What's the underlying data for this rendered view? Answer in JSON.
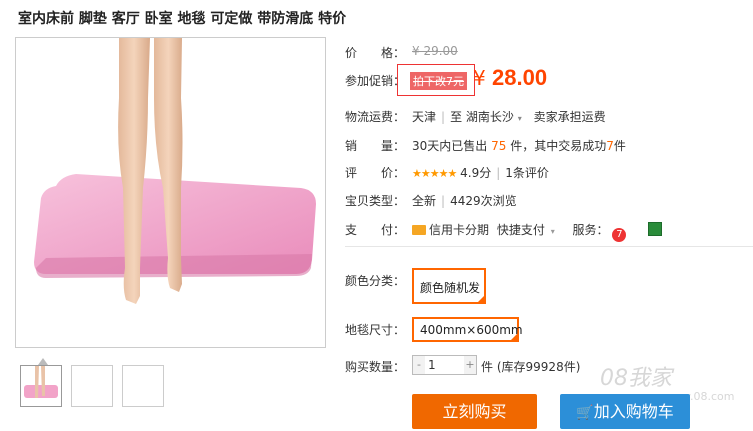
{
  "product": {
    "title": "室内床前 脚垫 客厅 卧室 地毯 可定做 带防滑底 特价"
  },
  "price_section": {
    "price_label": "价　　格：",
    "original_price": "¥ 29.00",
    "promo_label": "参加促销：",
    "promo_tag": "拍下改7元",
    "currency": "¥",
    "promo_price": "28.00"
  },
  "shipping": {
    "label": "物流运费：",
    "from": "天津",
    "to_prefix": "至",
    "to": "湖南长沙",
    "note": "卖家承担运费"
  },
  "sales": {
    "label": "销　　量：",
    "text_before": "30天内已售出",
    "sold": "75",
    "text_mid": "件，其中交易成功",
    "success": "7",
    "text_after": "件"
  },
  "rating": {
    "label": "评　　价：",
    "stars": "★★★★★",
    "score": "4.9分",
    "reviews": "1条评价"
  },
  "item_type": {
    "label": "宝贝类型：",
    "condition": "全新",
    "views": "4429次浏览"
  },
  "payment": {
    "label": "支　　付：",
    "credit": "信用卡分期",
    "quick": "快捷支付",
    "service_label": "服务："
  },
  "options": {
    "color_label": "颜色分类：",
    "color_value": "颜色随机发",
    "size_label": "地毯尺寸：",
    "size_value": "400mm×600mm"
  },
  "quantity": {
    "label": "购买数量：",
    "minus": "-",
    "value": "1",
    "plus": "+",
    "unit": "件",
    "stock": "(库存99928件)"
  },
  "buttons": {
    "buy_now": "立刻购买",
    "add_to_cart": "加入购物车"
  },
  "watermark": {
    "text": "08我家",
    "sub": "www.08.com"
  },
  "colors": {
    "accent": "#f06800",
    "cart_blue": "#2c8fd8",
    "price_red": "#ff4400",
    "rug_pink": "#f2a3c8"
  }
}
